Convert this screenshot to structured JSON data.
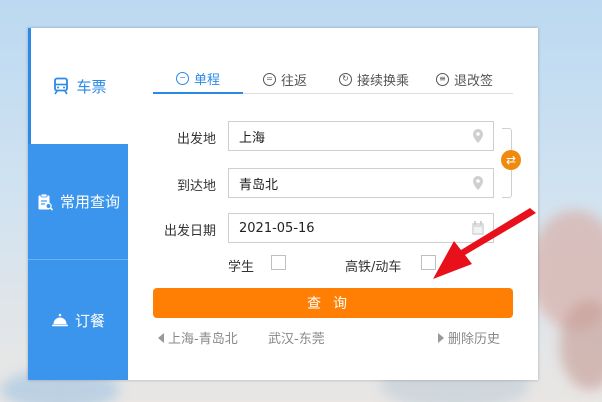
{
  "sidebar": {
    "ticket": "车票",
    "query": "常用查询",
    "meal": "订餐"
  },
  "tabs": [
    {
      "label": "单程",
      "icon": "minus-circle-icon"
    },
    {
      "label": "往返",
      "icon": "equals-circle-icon"
    },
    {
      "label": "接续换乘",
      "icon": "refresh-circle-icon"
    },
    {
      "label": "退改签",
      "icon": "list-circle-icon"
    }
  ],
  "form": {
    "from_label": "出发地",
    "from_value": "上海",
    "to_label": "到达地",
    "to_value": "青岛北",
    "date_label": "出发日期",
    "date_value": "2021-05-16",
    "student_label": "学生",
    "hsr_label": "高铁/动车"
  },
  "search_label": "查询",
  "history": {
    "items": [
      "上海-青岛北",
      "武汉-东莞"
    ],
    "clear_label": "删除历史"
  },
  "colors": {
    "accent_blue": "#2b8ae6",
    "sidebar_blue": "#3b95ec",
    "search_orange": "#ff7f05",
    "arrow_red": "#e8101a"
  }
}
